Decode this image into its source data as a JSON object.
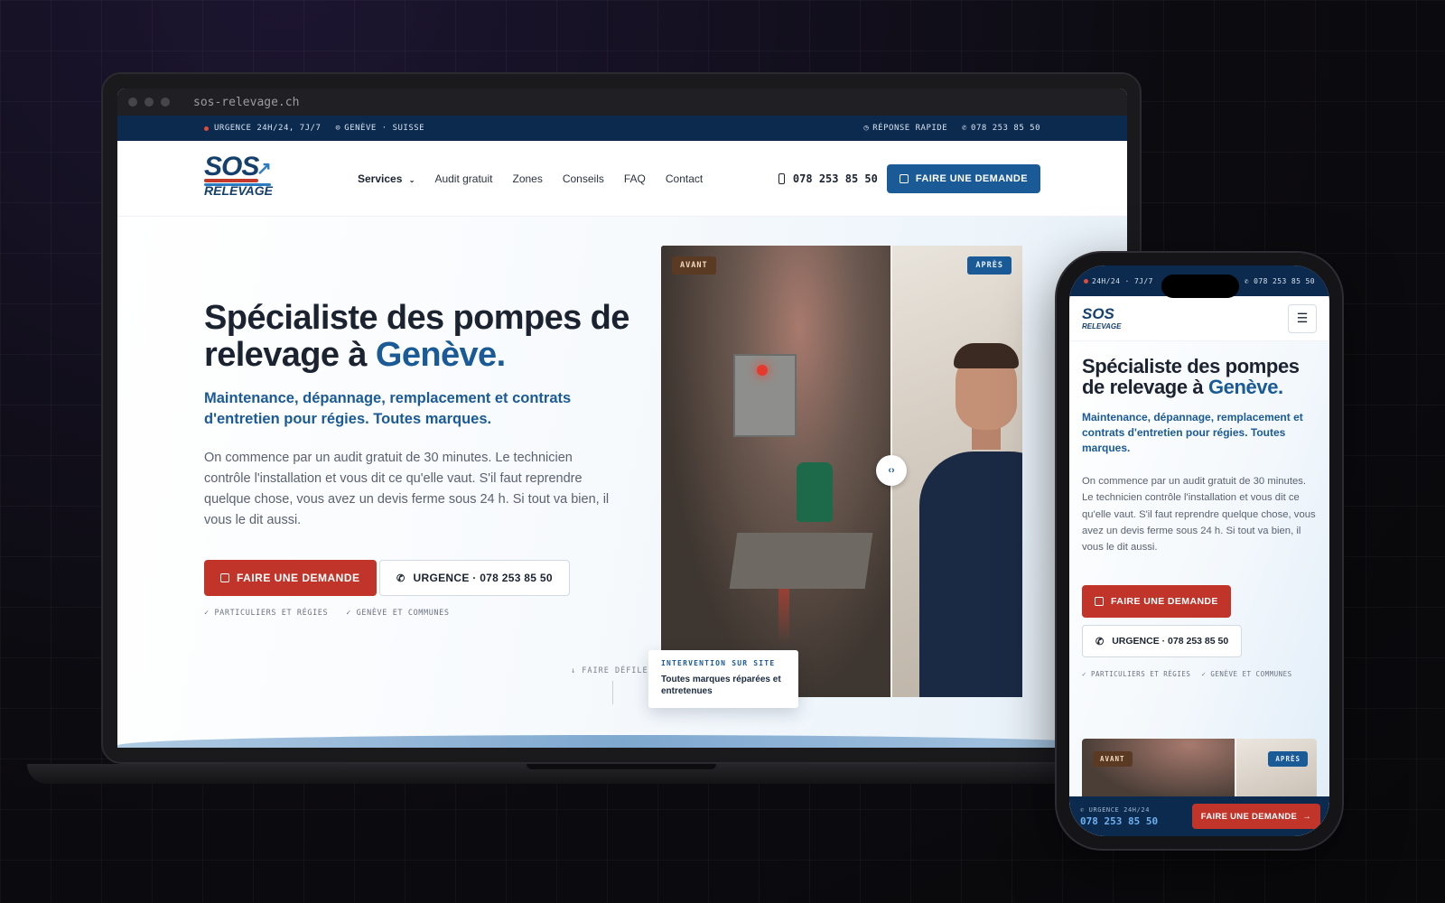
{
  "browser": {
    "url": "sos-relevage.ch"
  },
  "topbar": {
    "urgence": "URGENCE 24H/24, 7J/7",
    "location": "GENÈVE · SUISSE",
    "reponse": "RÉPONSE RAPIDE",
    "phone": "078 253 85 50"
  },
  "logo": {
    "line1": "SOS",
    "line2": "RELEVAGE"
  },
  "nav": {
    "items": [
      "Services",
      "Audit gratuit",
      "Zones",
      "Conseils",
      "FAQ",
      "Contact"
    ],
    "phone": "078 253 85 50",
    "cta": "FAIRE UNE DEMANDE"
  },
  "hero": {
    "title_main": "Spécialiste des pompes de relevage à ",
    "title_accent": "Genève.",
    "subtitle": "Maintenance, dépannage, remplacement et contrats d'entretien pour régies. Toutes marques.",
    "paragraph": "On commence par un audit gratuit de 30 minutes. Le technicien contrôle l'installation et vous dit ce qu'elle vaut. S'il faut reprendre quelque chose, vous avez un devis ferme sous 24 h. Si tout va bien, il vous le dit aussi.",
    "cta_primary": "FAIRE UNE DEMANDE",
    "cta_secondary": "URGENCE · 078 253 85 50",
    "check1": "PARTICULIERS ET RÉGIES",
    "check2": "GENÈVE ET COMMUNES",
    "scroll": "FAIRE DÉFILER"
  },
  "compare": {
    "before": "AVANT",
    "after": "APRÈS",
    "card_label": "INTERVENTION SUR SITE",
    "card_text": "Toutes marques réparées et entretenues"
  },
  "mobile": {
    "top_left": "24H/24 · 7J/7",
    "top_right": "078 253 85 50",
    "sticky_label": "URGENCE 24H/24",
    "sticky_phone": "078 253 85 50",
    "sticky_cta": "FAIRE UNE DEMANDE"
  },
  "colors": {
    "navy": "#0b2a4d",
    "brand_blue": "#1a5a97",
    "brand_red": "#c0342a"
  }
}
